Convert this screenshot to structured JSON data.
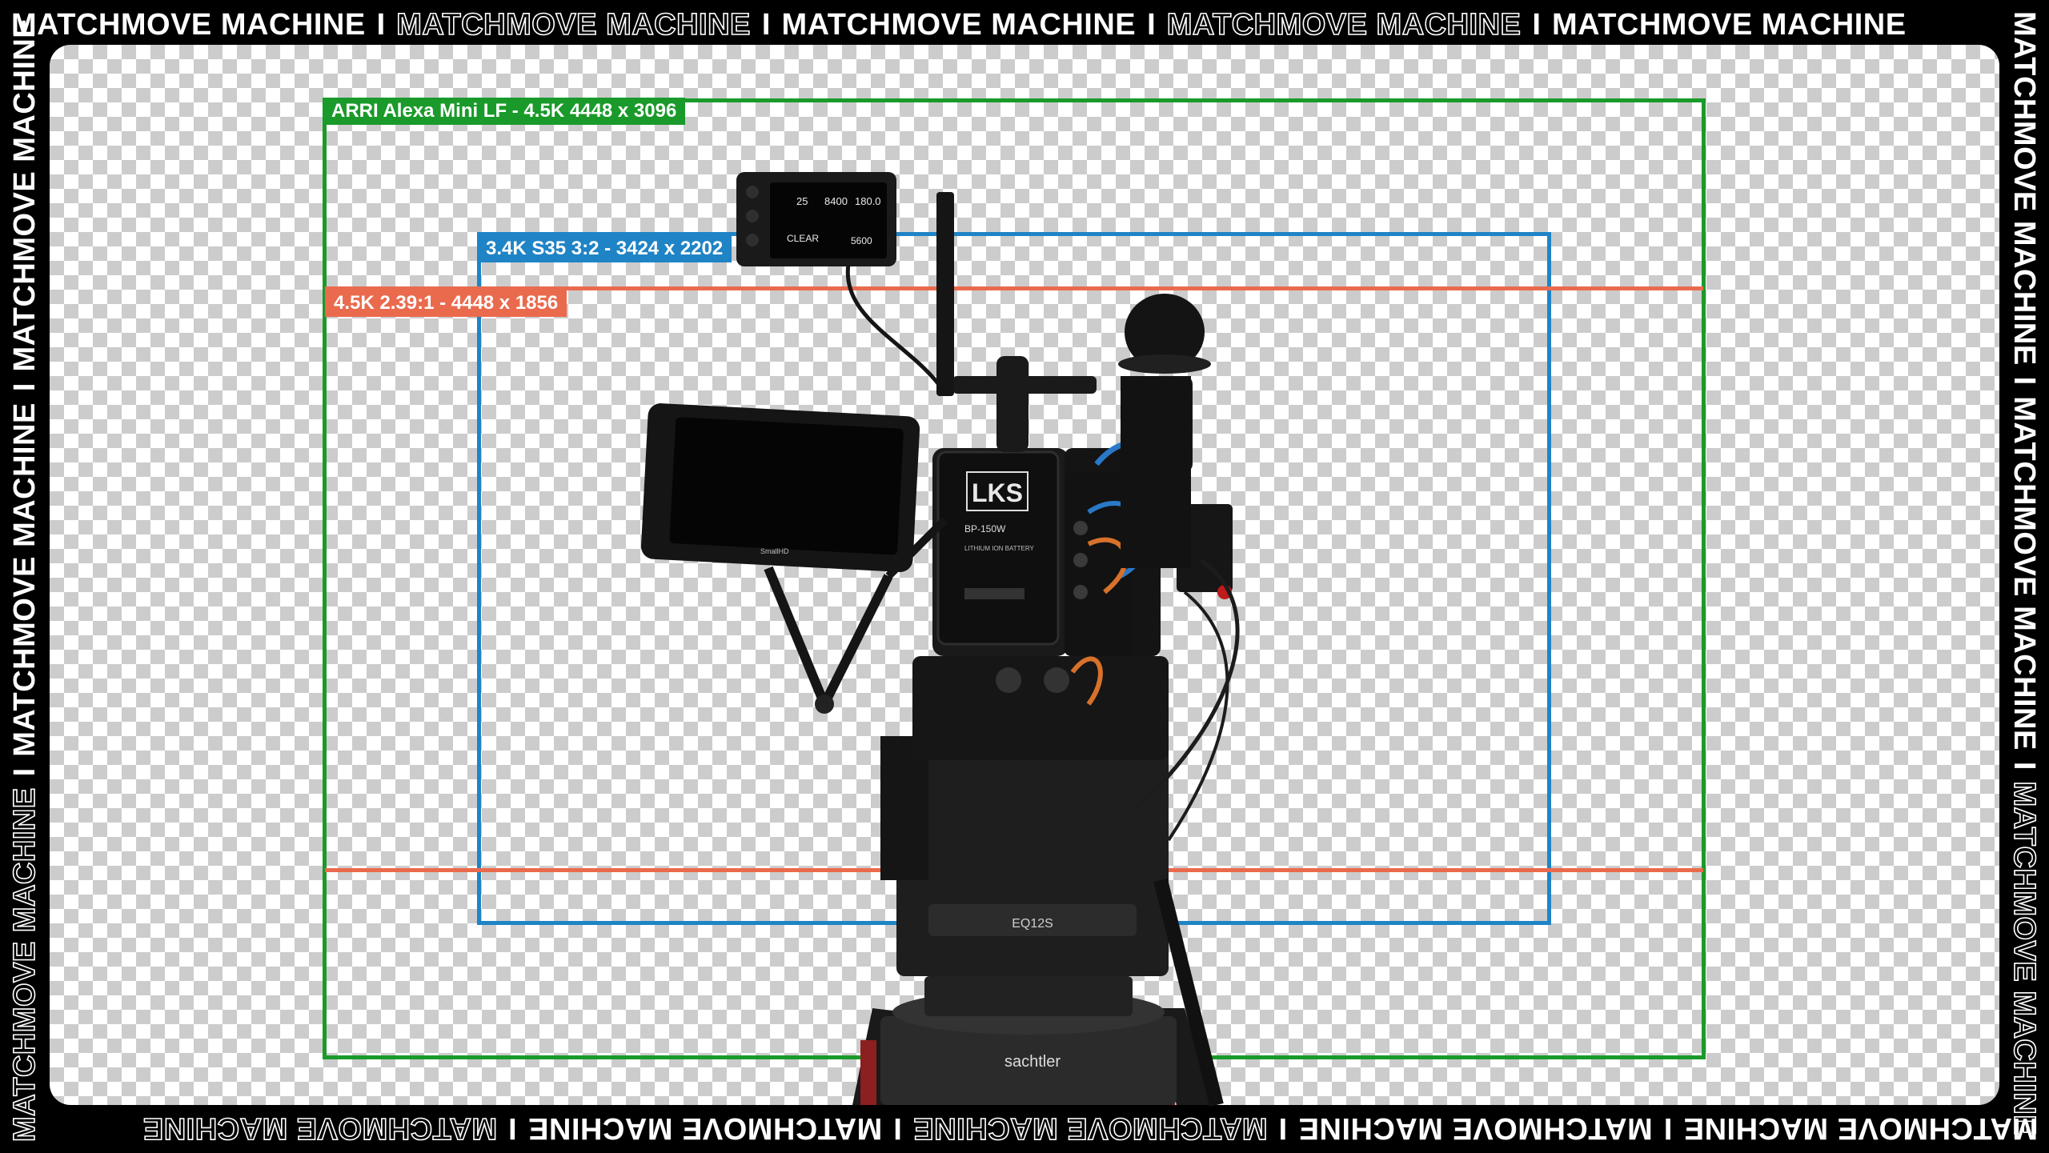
{
  "banner": {
    "text": "MATCHMOVE MACHINE",
    "segments": [
      "MATCHMOVE MACHINE",
      "MATCHMOVE MACHINE",
      "MATCHMOVE MACHINE",
      "MATCHMOVE MACHINE",
      "MATCHMOVE MACHINE"
    ],
    "separator": "I"
  },
  "formats": {
    "full": {
      "label": "ARRI Alexa Mini LF - 4.5K 4448 x 3096",
      "color": "#1a9a2a"
    },
    "s35": {
      "label": "3.4K S35 3:2 - 3424 x 2202",
      "color": "#1f84c6"
    },
    "scope": {
      "label": "4.5K 2.39:1 - 4448 x 1856",
      "color": "#ea6a4d"
    }
  },
  "camera": {
    "battery_brand": "LKS",
    "battery_model": "BP-150W",
    "battery_spec": "LITHIUM ION BATTERY",
    "tripod_brand": "sachtler",
    "head_label": "EQ12S",
    "monitor_brand": "SmallHD",
    "panel_readouts": [
      "25",
      "8400",
      "180.0",
      "CLEAR",
      "5600"
    ]
  },
  "colors": {
    "background": "#000000",
    "checker_light": "#ffffff",
    "checker_dark": "#cccccc"
  }
}
